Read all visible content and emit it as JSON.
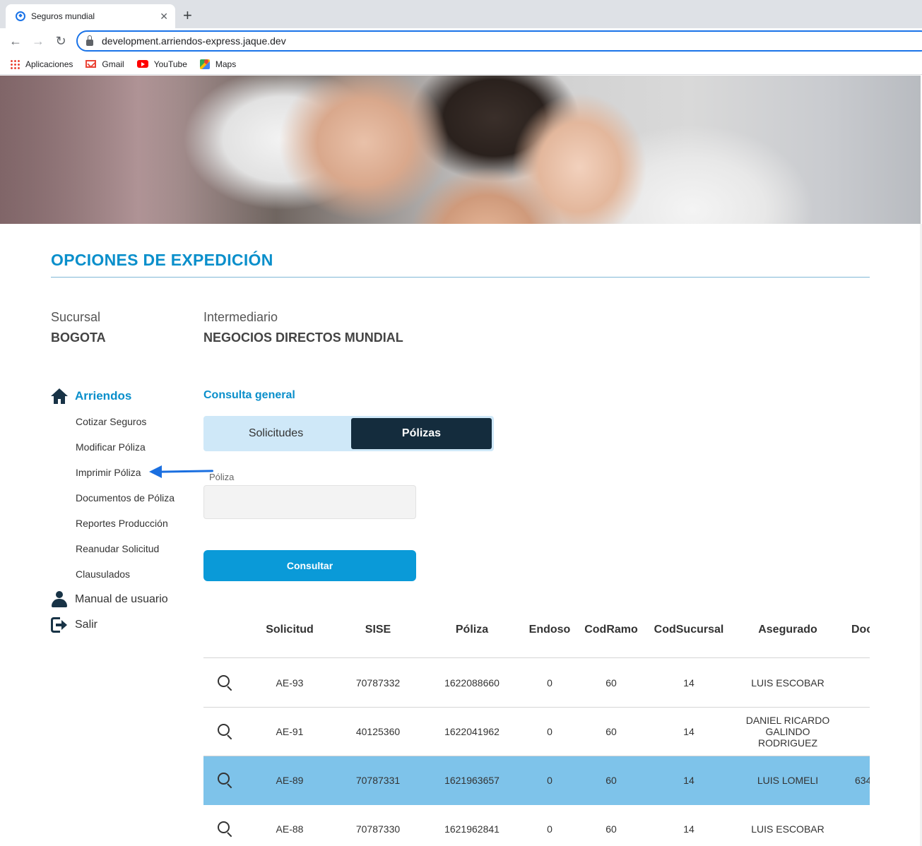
{
  "browser": {
    "tab_title": "Seguros mundial",
    "tab_close": "✕",
    "new_tab": "+",
    "url": "development.arriendos-express.jaque.dev",
    "nav": {
      "back": "←",
      "forward": "→",
      "reload": "↻"
    },
    "bookmarks": [
      {
        "label": "Aplicaciones",
        "icon": "apps-grid-icon"
      },
      {
        "label": "Gmail",
        "icon": "gmail-icon"
      },
      {
        "label": "YouTube",
        "icon": "youtube-icon"
      },
      {
        "label": "Maps",
        "icon": "maps-icon"
      }
    ]
  },
  "page": {
    "section_title": "OPCIONES DE EXPEDICIÓN",
    "sucursal": {
      "label": "Sucursal",
      "value": "BOGOTA"
    },
    "intermediario": {
      "label": "Intermediario",
      "value": "NEGOCIOS DIRECTOS MUNDIAL"
    }
  },
  "sidebar": {
    "heading": "Arriendos",
    "items": [
      "Cotizar Seguros",
      "Modificar Póliza",
      "Imprimir Póliza",
      "Documentos de Póliza",
      "Reportes Producción",
      "Reanudar Solicitud",
      "Clausulados"
    ],
    "manual": "Manual de usuario",
    "logout": "Salir"
  },
  "main": {
    "title": "Consulta general",
    "toggle": {
      "solicitudes": "Solicitudes",
      "polizas": "Pólizas",
      "active": "polizas"
    },
    "poliza_field": {
      "label": "Póliza",
      "value": "",
      "placeholder": ""
    },
    "submit_label": "Consultar"
  },
  "table": {
    "columns": [
      "Solicitud",
      "SISE",
      "Póliza",
      "Endoso",
      "CodRamo",
      "CodSucursal",
      "Asegurado",
      "Doc"
    ],
    "rows": [
      {
        "solicitud": "AE-93",
        "sise": "70787332",
        "poliza": "1622088660",
        "endoso": "0",
        "codramo": "60",
        "codsucursal": "14",
        "asegurado": "LUIS ESCOBAR",
        "doc": "",
        "selected": false
      },
      {
        "solicitud": "AE-91",
        "sise": "40125360",
        "poliza": "1622041962",
        "endoso": "0",
        "codramo": "60",
        "codsucursal": "14",
        "asegurado": "DANIEL RICARDO GALINDO RODRIGUEZ",
        "doc": "",
        "selected": false
      },
      {
        "solicitud": "AE-89",
        "sise": "70787331",
        "poliza": "1621963657",
        "endoso": "0",
        "codramo": "60",
        "codsucursal": "14",
        "asegurado": "LUIS LOMELI",
        "doc": "634",
        "selected": true
      },
      {
        "solicitud": "AE-88",
        "sise": "70787330",
        "poliza": "1621962841",
        "endoso": "0",
        "codramo": "60",
        "codsucursal": "14",
        "asegurado": "LUIS ESCOBAR",
        "doc": "",
        "selected": false
      }
    ]
  },
  "colors": {
    "accent": "#0a8fcb",
    "dark": "#142c3d",
    "toggle_bg": "#cfe8f8",
    "button": "#0a9ad8",
    "selected_row": "#7ec3ea",
    "annotation_arrow": "#1a6fe0"
  }
}
